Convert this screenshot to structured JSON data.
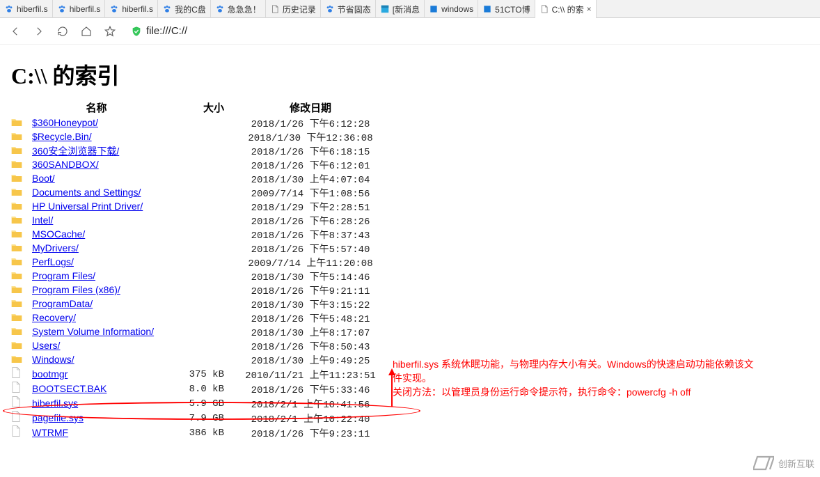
{
  "tabs": [
    {
      "label": "hiberfil.s",
      "favicon": "paw"
    },
    {
      "label": "hiberfil.s",
      "favicon": "paw"
    },
    {
      "label": "hiberfil.s",
      "favicon": "paw"
    },
    {
      "label": "我的C盘",
      "favicon": "paw"
    },
    {
      "label": "急急急！",
      "favicon": "paw"
    },
    {
      "label": "历史记录",
      "favicon": "file"
    },
    {
      "label": "节省固态",
      "favicon": "paw"
    },
    {
      "label": "[新消息",
      "favicon": "blue"
    },
    {
      "label": "windows",
      "favicon": "blue2"
    },
    {
      "label": "51CTO博",
      "favicon": "blue2"
    },
    {
      "label": "C:\\\\ 的索",
      "favicon": "file"
    }
  ],
  "active_tab_index": 10,
  "url": "file:///C://",
  "page_title": "C:\\\\ 的索引",
  "columns": {
    "name": "名称",
    "size": "大小",
    "date": "修改日期"
  },
  "rows": [
    {
      "type": "folder",
      "name": "$360Honeypot/",
      "size": "",
      "date": "2018/1/26 下午6:12:28"
    },
    {
      "type": "folder",
      "name": "$Recycle.Bin/",
      "size": "",
      "date": "2018/1/30 下午12:36:08"
    },
    {
      "type": "folder",
      "name": "360安全浏览器下载/",
      "size": "",
      "date": "2018/1/26 下午6:18:15"
    },
    {
      "type": "folder",
      "name": "360SANDBOX/",
      "size": "",
      "date": "2018/1/26 下午6:12:01"
    },
    {
      "type": "folder",
      "name": "Boot/",
      "size": "",
      "date": "2018/1/30 上午4:07:04"
    },
    {
      "type": "folder",
      "name": "Documents and Settings/",
      "size": "",
      "date": "2009/7/14 下午1:08:56"
    },
    {
      "type": "folder",
      "name": "HP Universal Print Driver/",
      "size": "",
      "date": "2018/1/29 下午2:28:51"
    },
    {
      "type": "folder",
      "name": "Intel/",
      "size": "",
      "date": "2018/1/26 下午6:28:26"
    },
    {
      "type": "folder",
      "name": "MSOCache/",
      "size": "",
      "date": "2018/1/26 下午8:37:43"
    },
    {
      "type": "folder",
      "name": "MyDrivers/",
      "size": "",
      "date": "2018/1/26 下午5:57:40"
    },
    {
      "type": "folder",
      "name": "PerfLogs/",
      "size": "",
      "date": "2009/7/14 上午11:20:08"
    },
    {
      "type": "folder",
      "name": "Program Files/",
      "size": "",
      "date": "2018/1/30 下午5:14:46"
    },
    {
      "type": "folder",
      "name": "Program Files (x86)/",
      "size": "",
      "date": "2018/1/26 下午9:21:11"
    },
    {
      "type": "folder",
      "name": "ProgramData/",
      "size": "",
      "date": "2018/1/30 下午3:15:22"
    },
    {
      "type": "folder",
      "name": "Recovery/",
      "size": "",
      "date": "2018/1/26 下午5:48:21"
    },
    {
      "type": "folder",
      "name": "System Volume Information/",
      "size": "",
      "date": "2018/1/30 上午8:17:07"
    },
    {
      "type": "folder",
      "name": "Users/",
      "size": "",
      "date": "2018/1/26 下午8:50:43"
    },
    {
      "type": "folder",
      "name": "Windows/",
      "size": "",
      "date": "2018/1/30 上午9:49:25"
    },
    {
      "type": "file",
      "name": "bootmgr",
      "size": "375 kB",
      "date": "2010/11/21 上午11:23:51"
    },
    {
      "type": "file",
      "name": "BOOTSECT.BAK",
      "size": "8.0 kB",
      "date": "2018/1/26 下午5:33:46"
    },
    {
      "type": "file",
      "name": "hiberfil.sys",
      "size": "5.9 GB",
      "date": "2018/2/1 上午10:41:56"
    },
    {
      "type": "file",
      "name": "pagefile.sys",
      "size": "7.9 GB",
      "date": "2018/2/1 上午10:22:40"
    },
    {
      "type": "file",
      "name": "WTRMF",
      "size": "386 kB",
      "date": "2018/1/26 下午9:23:11"
    }
  ],
  "annotation": {
    "line1": "hiberfil.sys 系统休眠功能，与物理内存大小有关。Windows的快速启动功能依赖该文",
    "line2": "件实现。",
    "line3": "关闭方法：以管理员身份运行命令提示符，执行命令：powercfg -h off"
  },
  "watermark": "创新互联"
}
